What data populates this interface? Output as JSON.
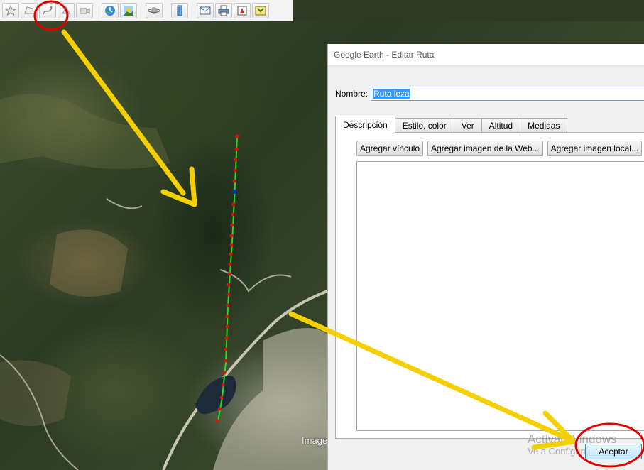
{
  "toolbar": {
    "buttons": [
      {
        "name": "add-placemark-icon"
      },
      {
        "name": "add-polygon-icon"
      },
      {
        "name": "add-path-icon"
      },
      {
        "name": "add-overlay-icon"
      },
      {
        "name": "record-tour-icon"
      },
      {
        "name": "historical-imagery-icon"
      },
      {
        "name": "sunlight-icon"
      },
      {
        "name": "switch-planet-icon"
      },
      {
        "name": "ruler-icon"
      },
      {
        "name": "email-icon"
      },
      {
        "name": "print-icon"
      },
      {
        "name": "save-image-icon"
      },
      {
        "name": "view-in-maps-icon"
      }
    ]
  },
  "map": {
    "attribution": "Image"
  },
  "dialog": {
    "title": "Google Earth - Editar Ruta",
    "name_label": "Nombre:",
    "name_value": "Ruta leza",
    "tabs": [
      "Descripción",
      "Estilo, color",
      "Ver",
      "Altitud",
      "Medidas"
    ],
    "active_tab": "Descripción",
    "buttons": {
      "add_link": "Agregar vínculo",
      "add_web_image": "Agregar imagen de la Web...",
      "add_local_image": "Agregar imagen local..."
    },
    "ok_label": "Aceptar"
  },
  "watermark": {
    "line1": "Activar Windows",
    "line2": "Ve a Configuración para"
  },
  "colors": {
    "path_line": "#22dd22",
    "path_points": "#e01010",
    "selected_point": "#1a2bd6",
    "annotation_arrow": "#f5d000",
    "annotation_circle": "#e00000"
  }
}
